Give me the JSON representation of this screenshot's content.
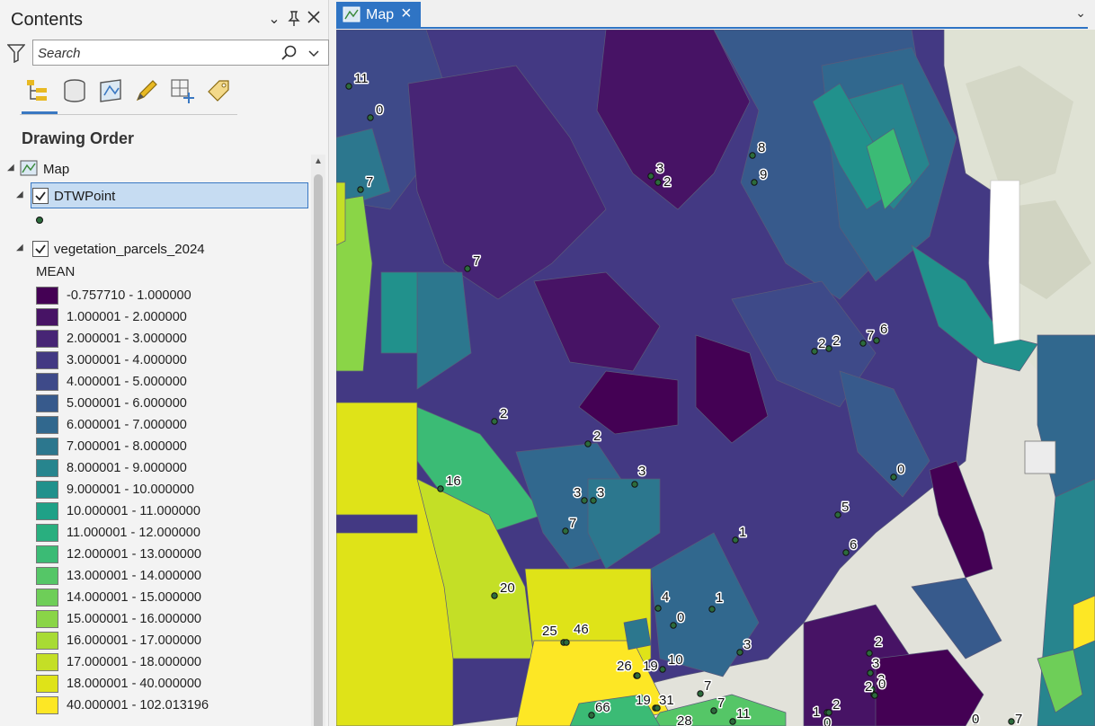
{
  "contents": {
    "title": "Contents",
    "search_placeholder": "Search",
    "section_title": "Drawing Order",
    "map_label": "Map",
    "layer_points": "DTWPoint",
    "layer_parcels": "vegetation_parcels_2024",
    "legend_field": "MEAN",
    "legend": [
      {
        "label": "-0.757710 - 1.000000",
        "color": "#440154"
      },
      {
        "label": "1.000001 - 2.000000",
        "color": "#471365"
      },
      {
        "label": "2.000001 - 3.000000",
        "color": "#472575"
      },
      {
        "label": "3.000001 - 4.000000",
        "color": "#433983"
      },
      {
        "label": "4.000001 - 5.000000",
        "color": "#3e4a89"
      },
      {
        "label": "5.000001 - 6.000000",
        "color": "#375a8c"
      },
      {
        "label": "6.000001 - 7.000000",
        "color": "#31688e"
      },
      {
        "label": "7.000001 - 8.000000",
        "color": "#2c778e"
      },
      {
        "label": "8.000001 - 9.000000",
        "color": "#27858e"
      },
      {
        "label": "9.000001 - 10.000000",
        "color": "#21918c"
      },
      {
        "label": "10.000001 - 11.000000",
        "color": "#1fa187"
      },
      {
        "label": "11.000001 - 12.000000",
        "color": "#29af7f"
      },
      {
        "label": "12.000001 - 13.000000",
        "color": "#3bbb75"
      },
      {
        "label": "13.000001 - 14.000000",
        "color": "#55c667"
      },
      {
        "label": "14.000001 - 15.000000",
        "color": "#6ece58"
      },
      {
        "label": "15.000001 - 16.000000",
        "color": "#8ad547"
      },
      {
        "label": "16.000001 - 17.000000",
        "color": "#a8db34"
      },
      {
        "label": "17.000001 - 18.000000",
        "color": "#c4df26"
      },
      {
        "label": "18.000001 - 40.000000",
        "color": "#dfe318"
      },
      {
        "label": "40.000001 - 102.013196",
        "color": "#fde725"
      }
    ]
  },
  "map_tab": {
    "label": "Map"
  },
  "map_points": [
    "11",
    "0",
    "7",
    "3",
    "2",
    "8",
    "9",
    "7",
    "2",
    "2",
    "7",
    "6",
    "2",
    "2",
    "16",
    "3",
    "3",
    "3",
    "7",
    "0",
    "5",
    "6",
    "1",
    "20",
    "4",
    "0",
    "1",
    "25",
    "46",
    "3",
    "2",
    "26",
    "19",
    "10",
    "3",
    "2",
    "2",
    "0",
    "7",
    "19",
    "31",
    "7",
    "66",
    "28",
    "11",
    "1",
    "2",
    "0",
    "7",
    "0"
  ]
}
